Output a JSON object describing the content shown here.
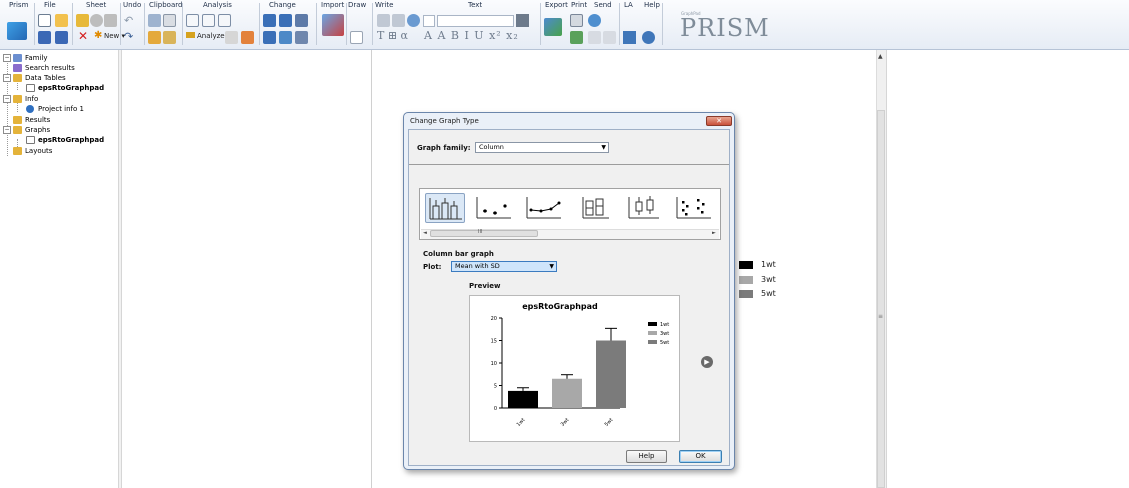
{
  "toolbar": {
    "sections": {
      "prism": "Prism",
      "file": "File",
      "sheet": "Sheet",
      "undo": "Undo",
      "clipboard": "Clipboard",
      "analysis": "Analysis",
      "change": "Change",
      "import": "Import",
      "draw": "Draw",
      "write": "Write",
      "text": "Text",
      "export": "Export",
      "print": "Print",
      "send": "Send",
      "la": "LA",
      "help": "Help"
    },
    "new_label": "New",
    "analyze_label": "Analyze",
    "logo_small": "GraphPad",
    "logo": "PRISM",
    "colors": {
      "background": "#e6ecf5",
      "accent": "#3a6ea5"
    }
  },
  "navigator": {
    "family": "Family",
    "search_results": "Search results",
    "data_tables": "Data Tables",
    "data_table_item": "epsRtoGraphpad",
    "info": "Info",
    "project_info": "Project info 1",
    "results": "Results",
    "graphs": "Graphs",
    "graph_item": "epsRtoGraphpad",
    "layouts": "Layouts"
  },
  "background_legend": [
    {
      "label": "1wt",
      "color": "#000000"
    },
    {
      "label": "3wt",
      "color": "#a8a8a8"
    },
    {
      "label": "5wt",
      "color": "#7b7b7b"
    }
  ],
  "dialog": {
    "title": "Change Graph Type",
    "graph_family_label": "Graph family:",
    "graph_family_value": "Column",
    "scroll_marker": "III",
    "section_title": "Column bar graph",
    "plot_label": "Plot:",
    "plot_value": "Mean with SD",
    "preview_label": "Preview",
    "help_button": "Help",
    "ok_button": "OK",
    "gallery_icons": [
      "column-bars-icon",
      "scatter-dots-icon",
      "connected-line-icon",
      "box-plot-icon",
      "box-whisker-icon",
      "scattered-points-icon"
    ]
  },
  "chart_data": {
    "type": "bar",
    "title": "epsRtoGraphpad",
    "categories": [
      "1wt",
      "3wt",
      "5wt"
    ],
    "values": [
      3.8,
      6.5,
      15.0
    ],
    "errors": [
      0.7,
      0.9,
      2.7
    ],
    "colors": [
      "#000000",
      "#a8a8a8",
      "#7b7b7b"
    ],
    "ylim": [
      0,
      20
    ],
    "yticks": [
      "0",
      "5",
      "10",
      "15",
      "20"
    ],
    "legend": [
      "1wt",
      "3wt",
      "5wt"
    ],
    "legend_position": "top-right",
    "error_bars": "Mean with SD"
  }
}
